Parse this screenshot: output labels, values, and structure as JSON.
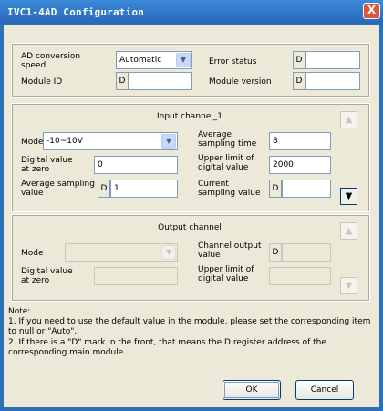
{
  "window": {
    "title": "IVC1-4AD Configuration",
    "close_glyph": "X"
  },
  "top": {
    "ad_speed_label": "AD conversion speed",
    "ad_speed_value": "Automatic",
    "error_status_label": "Error status",
    "module_id_label": "Module ID",
    "module_version_label": "Module version",
    "d_mark": "D"
  },
  "input_channel": {
    "title": "Input channel_1",
    "mode_label": "Mode",
    "mode_value": "-10~10V",
    "avg_time_label": "Average sampling time",
    "avg_time_value": "8",
    "digital_zero_label": "Digital value at zero",
    "digital_zero_value": "0",
    "upper_limit_label": "Upper limit of digital value",
    "upper_limit_value": "2000",
    "avg_sampling_value_label": "Average sampling value",
    "avg_sampling_value": "1",
    "current_sampling_label": "Current sampling value"
  },
  "output_channel": {
    "title": "Output channel",
    "mode_label": "Mode",
    "channel_output_label": "Channel output value",
    "digital_zero_label": "Digital value at zero",
    "upper_limit_label": "Upper limit of digital value"
  },
  "notes": {
    "heading": "Note:",
    "line1": "1. If you need to use the default value in the module, please set the corresponding item to null or \"Auto\".",
    "line2": "2. If there is a \"D\" mark in the front, that means the D register address of the corresponding main module."
  },
  "buttons": {
    "ok": "OK",
    "cancel": "Cancel"
  },
  "icons": {
    "up": "up-arrow-icon",
    "down": "down-arrow-icon",
    "dropdown": "chevron-down-icon"
  }
}
